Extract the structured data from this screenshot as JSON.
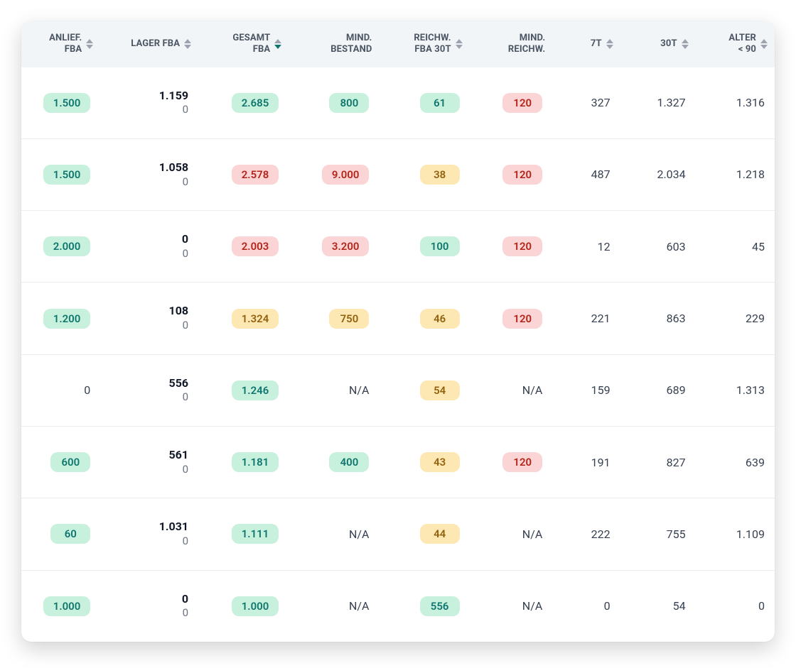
{
  "columns": [
    {
      "key": "anlief",
      "label": "ANLIEF.\nFBA",
      "sortable": true,
      "sorted": null
    },
    {
      "key": "lager",
      "label": "LAGER FBA",
      "sortable": true,
      "sorted": null
    },
    {
      "key": "gesamt",
      "label": "GESAMT\nFBA",
      "sortable": true,
      "sorted": "down"
    },
    {
      "key": "mindbest",
      "label": "MIND.\nBESTAND",
      "sortable": false,
      "sorted": null
    },
    {
      "key": "reichw",
      "label": "REICHW.\nFBA 30T",
      "sortable": true,
      "sorted": null
    },
    {
      "key": "mindrw",
      "label": "MIND.\nREICHW.",
      "sortable": false,
      "sorted": null
    },
    {
      "key": "t7",
      "label": "7T",
      "sortable": true,
      "sorted": null
    },
    {
      "key": "t30",
      "label": "30T",
      "sortable": true,
      "sorted": null
    },
    {
      "key": "alter",
      "label": "ALTER\n< 90",
      "sortable": true,
      "sorted": null
    }
  ],
  "rows": [
    {
      "anlief": {
        "value": "1.500",
        "style": "green"
      },
      "lager": {
        "top": "1.159",
        "bot": "0"
      },
      "gesamt": {
        "value": "2.685",
        "style": "green"
      },
      "mindbest": {
        "value": "800",
        "style": "green"
      },
      "reichw": {
        "value": "61",
        "style": "green"
      },
      "mindrw": {
        "value": "120",
        "style": "red"
      },
      "t7": {
        "value": "327"
      },
      "t30": {
        "value": "1.327"
      },
      "alter": {
        "value": "1.316"
      }
    },
    {
      "anlief": {
        "value": "1.500",
        "style": "green"
      },
      "lager": {
        "top": "1.058",
        "bot": "0"
      },
      "gesamt": {
        "value": "2.578",
        "style": "red"
      },
      "mindbest": {
        "value": "9.000",
        "style": "red"
      },
      "reichw": {
        "value": "38",
        "style": "yellow"
      },
      "mindrw": {
        "value": "120",
        "style": "red"
      },
      "t7": {
        "value": "487"
      },
      "t30": {
        "value": "2.034"
      },
      "alter": {
        "value": "1.218"
      }
    },
    {
      "anlief": {
        "value": "2.000",
        "style": "green"
      },
      "lager": {
        "top": "0",
        "bot": "0"
      },
      "gesamt": {
        "value": "2.003",
        "style": "red"
      },
      "mindbest": {
        "value": "3.200",
        "style": "red"
      },
      "reichw": {
        "value": "100",
        "style": "green"
      },
      "mindrw": {
        "value": "120",
        "style": "red"
      },
      "t7": {
        "value": "12"
      },
      "t30": {
        "value": "603"
      },
      "alter": {
        "value": "45"
      }
    },
    {
      "anlief": {
        "value": "1.200",
        "style": "green"
      },
      "lager": {
        "top": "108",
        "bot": "0"
      },
      "gesamt": {
        "value": "1.324",
        "style": "yellow"
      },
      "mindbest": {
        "value": "750",
        "style": "yellow"
      },
      "reichw": {
        "value": "46",
        "style": "yellow"
      },
      "mindrw": {
        "value": "120",
        "style": "red"
      },
      "t7": {
        "value": "221"
      },
      "t30": {
        "value": "863"
      },
      "alter": {
        "value": "229"
      }
    },
    {
      "anlief": {
        "value": "0"
      },
      "lager": {
        "top": "556",
        "bot": "0"
      },
      "gesamt": {
        "value": "1.246",
        "style": "green"
      },
      "mindbest": {
        "value": "N/A"
      },
      "reichw": {
        "value": "54",
        "style": "yellow"
      },
      "mindrw": {
        "value": "N/A"
      },
      "t7": {
        "value": "159"
      },
      "t30": {
        "value": "689"
      },
      "alter": {
        "value": "1.313"
      }
    },
    {
      "anlief": {
        "value": "600",
        "style": "green"
      },
      "lager": {
        "top": "561",
        "bot": "0"
      },
      "gesamt": {
        "value": "1.181",
        "style": "green"
      },
      "mindbest": {
        "value": "400",
        "style": "green"
      },
      "reichw": {
        "value": "43",
        "style": "yellow"
      },
      "mindrw": {
        "value": "120",
        "style": "red"
      },
      "t7": {
        "value": "191"
      },
      "t30": {
        "value": "827"
      },
      "alter": {
        "value": "639"
      }
    },
    {
      "anlief": {
        "value": "60",
        "style": "green"
      },
      "lager": {
        "top": "1.031",
        "bot": "0"
      },
      "gesamt": {
        "value": "1.111",
        "style": "green"
      },
      "mindbest": {
        "value": "N/A"
      },
      "reichw": {
        "value": "44",
        "style": "yellow"
      },
      "mindrw": {
        "value": "N/A"
      },
      "t7": {
        "value": "222"
      },
      "t30": {
        "value": "755"
      },
      "alter": {
        "value": "1.109"
      }
    },
    {
      "anlief": {
        "value": "1.000",
        "style": "green"
      },
      "lager": {
        "top": "0",
        "bot": "0"
      },
      "gesamt": {
        "value": "1.000",
        "style": "green"
      },
      "mindbest": {
        "value": "N/A"
      },
      "reichw": {
        "value": "556",
        "style": "green"
      },
      "mindrw": {
        "value": "N/A"
      },
      "t7": {
        "value": "0"
      },
      "t30": {
        "value": "54"
      },
      "alter": {
        "value": "0"
      }
    }
  ]
}
